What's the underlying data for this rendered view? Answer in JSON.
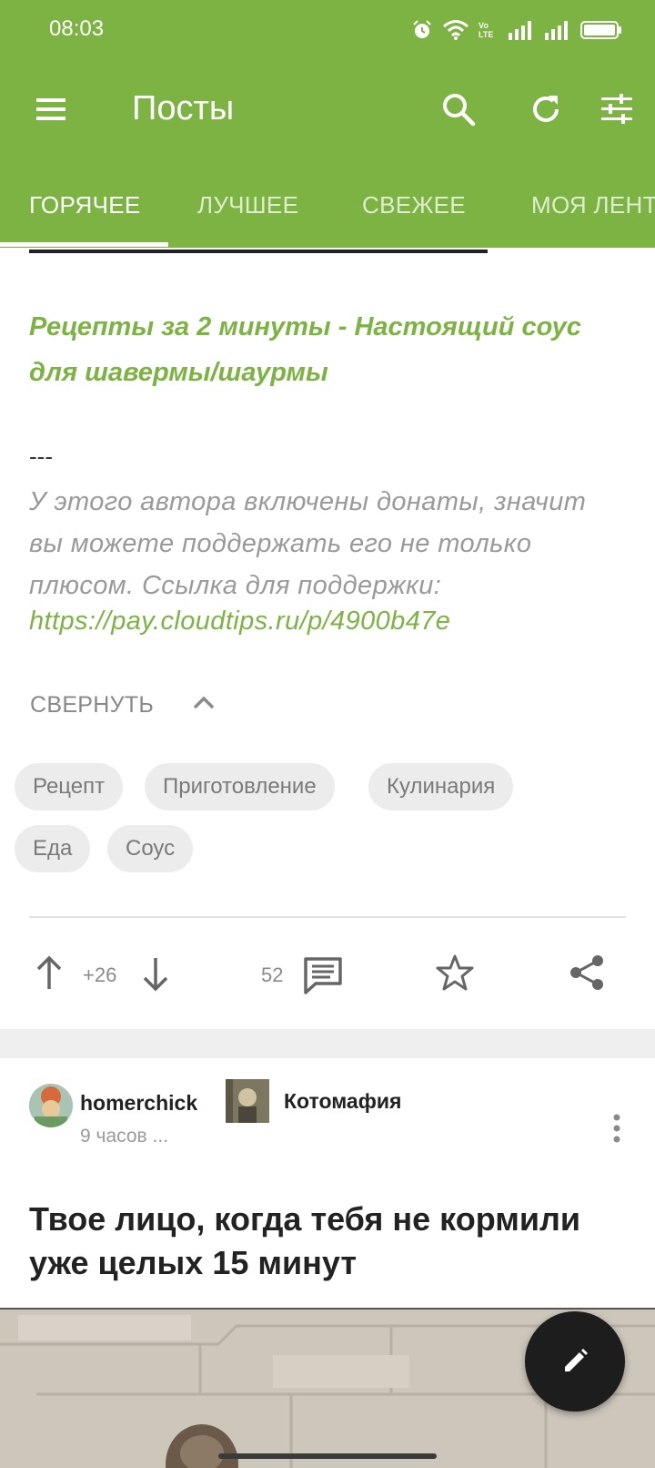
{
  "status_bar": {
    "time": "08:03",
    "network_label": "Vo LTE"
  },
  "app_bar": {
    "title": "Посты"
  },
  "tabs": [
    {
      "label": "ГОРЯЧЕЕ",
      "active": true
    },
    {
      "label": "ЛУЧШЕЕ",
      "active": false
    },
    {
      "label": "СВЕЖЕЕ",
      "active": false
    },
    {
      "label": "МОЯ ЛЕНТА",
      "active": false
    }
  ],
  "post1": {
    "link_text": "Рецепты за 2 минуты - Настоящий соус для шавермы/шаурмы",
    "separator": "---",
    "donate_text": "У этого автора включены донаты, значит вы можете поддержать его не только плюсом. Ссылка для поддержки:",
    "donate_link": "https://pay.cloudtips.ru/p/4900b47e",
    "collapse_label": "СВЕРНУТЬ",
    "tags": [
      "Рецепт",
      "Приготовление",
      "Кулинария",
      "Еда",
      "Соус"
    ],
    "rating": "+26",
    "comments": "52"
  },
  "post2": {
    "author": "homerchick",
    "time": "9 часов ...",
    "community": "Котомафия",
    "title": "Твое лицо, когда тебя не кормили уже целых 15 минут"
  },
  "colors": {
    "accent": "#7cb342",
    "fab": "#1d1d1d"
  },
  "icons": [
    "menu-icon",
    "search-icon",
    "refresh-icon",
    "filter-icon",
    "upvote-icon",
    "downvote-icon",
    "comment-icon",
    "star-icon",
    "share-icon",
    "more-icon",
    "edit-icon"
  ]
}
